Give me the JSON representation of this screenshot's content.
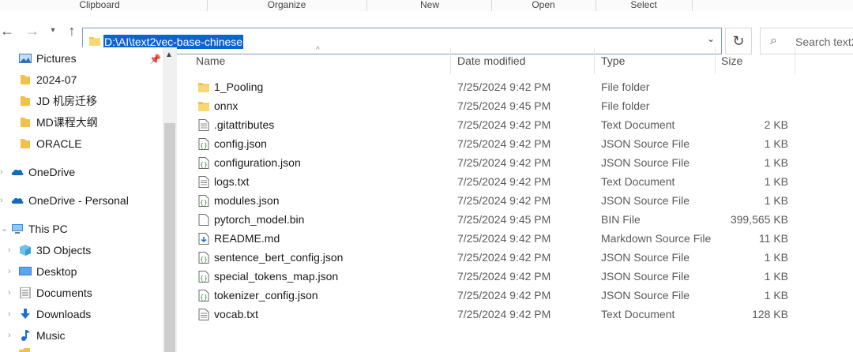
{
  "ribbon": {
    "groups": [
      "Clipboard",
      "Organize",
      "New",
      "Open",
      "Select"
    ]
  },
  "nav": {
    "address_path": "D:\\AI\\text2vec-base-chinese",
    "search_placeholder": "Search text2"
  },
  "sidebar": {
    "items": [
      {
        "label": "Pictures",
        "icon": "pictures-icon"
      },
      {
        "label": "2024-07",
        "icon": "folder-icon"
      },
      {
        "label": "JD 机房迁移",
        "icon": "folder-icon"
      },
      {
        "label": "MD课程大纲",
        "icon": "folder-icon"
      },
      {
        "label": "ORACLE",
        "icon": "folder-icon"
      },
      {
        "label": "OneDrive",
        "icon": "cloud-icon"
      },
      {
        "label": "OneDrive - Personal",
        "icon": "cloud-icon"
      },
      {
        "label": "This PC",
        "icon": "computer-icon"
      },
      {
        "label": "3D Objects",
        "icon": "3d-objects-icon"
      },
      {
        "label": "Desktop",
        "icon": "desktop-icon"
      },
      {
        "label": "Documents",
        "icon": "documents-icon"
      },
      {
        "label": "Downloads",
        "icon": "downloads-icon"
      },
      {
        "label": "Music",
        "icon": "music-icon"
      }
    ]
  },
  "columns": {
    "name": "Name",
    "date": "Date modified",
    "type": "Type",
    "size": "Size"
  },
  "files": [
    {
      "name": "1_Pooling",
      "date": "7/25/2024 9:42 PM",
      "type": "File folder",
      "size": "",
      "icon": "folder"
    },
    {
      "name": "onnx",
      "date": "7/25/2024 9:45 PM",
      "type": "File folder",
      "size": "",
      "icon": "folder"
    },
    {
      "name": ".gitattributes",
      "date": "7/25/2024 9:42 PM",
      "type": "Text Document",
      "size": "2 KB",
      "icon": "text"
    },
    {
      "name": "config.json",
      "date": "7/25/2024 9:42 PM",
      "type": "JSON Source File",
      "size": "1 KB",
      "icon": "json"
    },
    {
      "name": "configuration.json",
      "date": "7/25/2024 9:42 PM",
      "type": "JSON Source File",
      "size": "1 KB",
      "icon": "json"
    },
    {
      "name": "logs.txt",
      "date": "7/25/2024 9:42 PM",
      "type": "Text Document",
      "size": "1 KB",
      "icon": "text"
    },
    {
      "name": "modules.json",
      "date": "7/25/2024 9:42 PM",
      "type": "JSON Source File",
      "size": "1 KB",
      "icon": "json"
    },
    {
      "name": "pytorch_model.bin",
      "date": "7/25/2024 9:45 PM",
      "type": "BIN File",
      "size": "399,565 KB",
      "icon": "blank"
    },
    {
      "name": "README.md",
      "date": "7/25/2024 9:42 PM",
      "type": "Markdown Source File",
      "size": "11 KB",
      "icon": "markdown"
    },
    {
      "name": "sentence_bert_config.json",
      "date": "7/25/2024 9:42 PM",
      "type": "JSON Source File",
      "size": "1 KB",
      "icon": "json"
    },
    {
      "name": "special_tokens_map.json",
      "date": "7/25/2024 9:42 PM",
      "type": "JSON Source File",
      "size": "1 KB",
      "icon": "json"
    },
    {
      "name": "tokenizer_config.json",
      "date": "7/25/2024 9:42 PM",
      "type": "JSON Source File",
      "size": "1 KB",
      "icon": "json"
    },
    {
      "name": "vocab.txt",
      "date": "7/25/2024 9:42 PM",
      "type": "Text Document",
      "size": "128 KB",
      "icon": "text"
    }
  ],
  "colors": {
    "accent": "#0a64d6",
    "folder": "#f3c04a",
    "onedrive": "#0f6cbd"
  }
}
